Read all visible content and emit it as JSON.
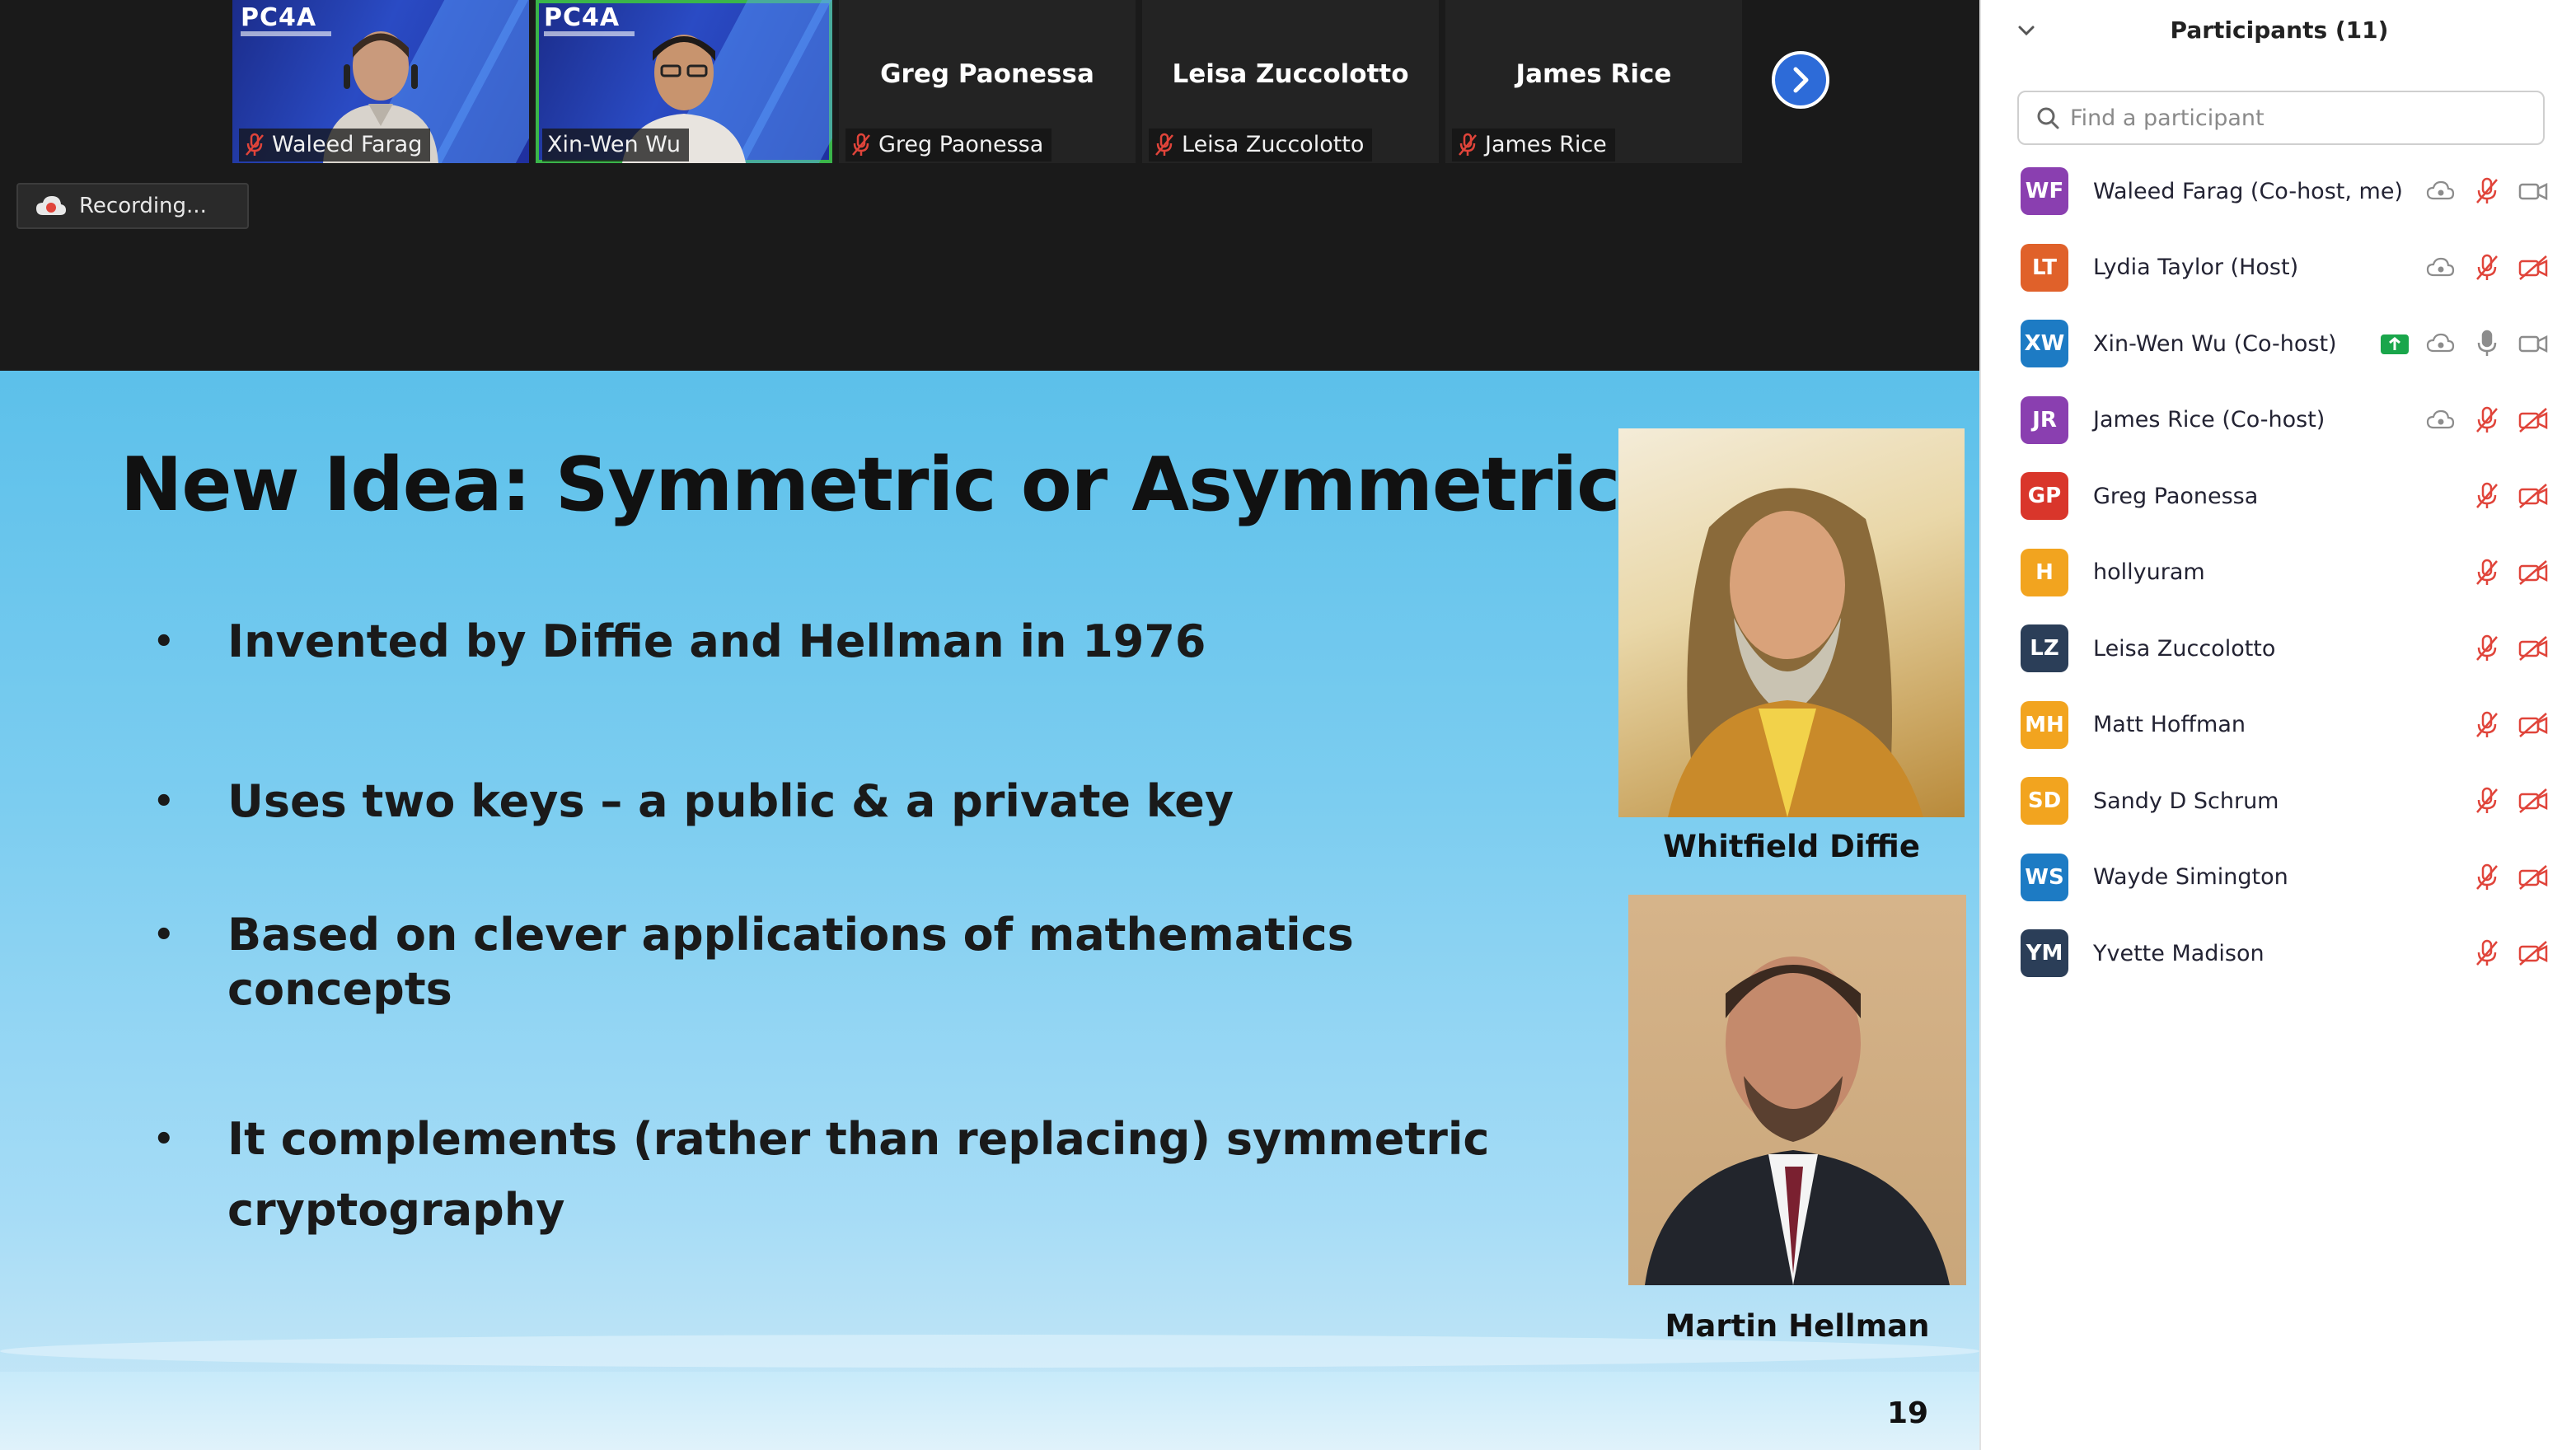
{
  "colors": {
    "accent_blue": "#2d6bd8",
    "muted_red": "#e0443a",
    "active_speaker_green": "#3ab54a",
    "share_green": "#1aa64b"
  },
  "video_strip": {
    "tiles": [
      {
        "name": "Waleed Farag",
        "has_video": true,
        "logo": "PC4A",
        "muted": true,
        "active": false
      },
      {
        "name": "Xin-Wen Wu",
        "has_video": true,
        "logo": "PC4A",
        "muted": false,
        "active": true
      },
      {
        "name": "Greg Paonessa",
        "has_video": false,
        "muted": true,
        "active": false
      },
      {
        "name": "Leisa Zuccolotto",
        "has_video": false,
        "muted": true,
        "active": false
      },
      {
        "name": "James Rice",
        "has_video": false,
        "muted": true,
        "active": false
      }
    ],
    "next_icon": "chevron-right-icon"
  },
  "recording": {
    "label": "Recording...",
    "icon": "cloud-recording-icon"
  },
  "slide": {
    "title": "New Idea: Symmetric or Asymmetric ?",
    "bullets": [
      "Invented by Diffie and Hellman in 1976",
      "Uses two keys – a public & a private key",
      "Based on clever applications of mathematics concepts",
      "It complements (rather than replacing) symmetric cryptography"
    ],
    "bullet_symbol": "•",
    "photos": [
      {
        "caption": "Whitfield Diffie"
      },
      {
        "caption": "Martin Hellman"
      }
    ],
    "page_number": "19"
  },
  "participants_panel": {
    "title": "Participants (11)",
    "collapse_icon": "chevron-down-icon",
    "search_placeholder": "Find a participant",
    "participants": [
      {
        "initials": "WF",
        "name": "Waleed Farag (Co-host, me)",
        "color": "#8a3fb0",
        "recording": true,
        "sharing": false,
        "muted": true,
        "video_off": false
      },
      {
        "initials": "LT",
        "name": "Lydia Taylor (Host)",
        "color": "#e0612a",
        "recording": true,
        "sharing": false,
        "muted": true,
        "video_off": true
      },
      {
        "initials": "XW",
        "name": "Xin-Wen Wu (Co-host)",
        "color": "#1d7bc4",
        "recording": true,
        "sharing": true,
        "muted": false,
        "video_off": false
      },
      {
        "initials": "JR",
        "name": "James Rice (Co-host)",
        "color": "#8a3fb0",
        "recording": true,
        "sharing": false,
        "muted": true,
        "video_off": true
      },
      {
        "initials": "GP",
        "name": "Greg Paonessa",
        "color": "#d9362b",
        "recording": false,
        "sharing": false,
        "muted": true,
        "video_off": true
      },
      {
        "initials": "H",
        "name": "hollyuram",
        "color": "#f2a41f",
        "recording": false,
        "sharing": false,
        "muted": true,
        "video_off": true
      },
      {
        "initials": "LZ",
        "name": "Leisa Zuccolotto",
        "color": "#2b3e58",
        "recording": false,
        "sharing": false,
        "muted": true,
        "video_off": true
      },
      {
        "initials": "MH",
        "name": "Matt Hoffman",
        "color": "#f2a41f",
        "recording": false,
        "sharing": false,
        "muted": true,
        "video_off": true
      },
      {
        "initials": "SD",
        "name": "Sandy D Schrum",
        "color": "#f2a41f",
        "recording": false,
        "sharing": false,
        "muted": true,
        "video_off": true
      },
      {
        "initials": "WS",
        "name": "Wayde Simington",
        "color": "#1d7bc4",
        "recording": false,
        "sharing": false,
        "muted": true,
        "video_off": true
      },
      {
        "initials": "YM",
        "name": "Yvette Madison",
        "color": "#2b3e58",
        "recording": false,
        "sharing": false,
        "muted": true,
        "video_off": true
      }
    ]
  }
}
